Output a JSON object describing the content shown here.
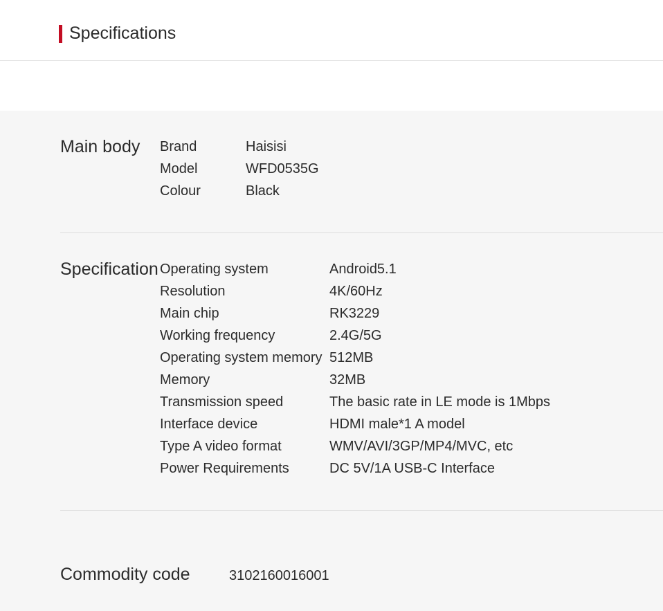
{
  "header": {
    "title": "Specifications"
  },
  "sections": {
    "main_body": {
      "title": "Main body",
      "items": [
        {
          "label": "Brand",
          "value": "Haisisi"
        },
        {
          "label": "Model",
          "value": "WFD0535G"
        },
        {
          "label": "Colour",
          "value": "Black"
        }
      ]
    },
    "specification": {
      "title": "Specification",
      "items": [
        {
          "label": "Operating system",
          "value": "Android5.1"
        },
        {
          "label": "Resolution",
          "value": "4K/60Hz"
        },
        {
          "label": "Main chip",
          "value": "RK3229"
        },
        {
          "label": "Working frequency",
          "value": "2.4G/5G"
        },
        {
          "label": "Operating system memory",
          "value": "512MB"
        },
        {
          "label": "Memory",
          "value": "32MB"
        },
        {
          "label": "Transmission speed",
          "value": "The basic rate in LE mode is 1Mbps"
        },
        {
          "label": "Interface device",
          "value": "HDMI male*1 A model"
        },
        {
          "label": "Type A video format",
          "value": "WMV/AVI/3GP/MP4/MVC, etc"
        },
        {
          "label": "Power Requirements",
          "value": "DC 5V/1A USB-C Interface"
        }
      ]
    },
    "commodity": {
      "title": "Commodity code",
      "value": "3102160016001"
    }
  }
}
